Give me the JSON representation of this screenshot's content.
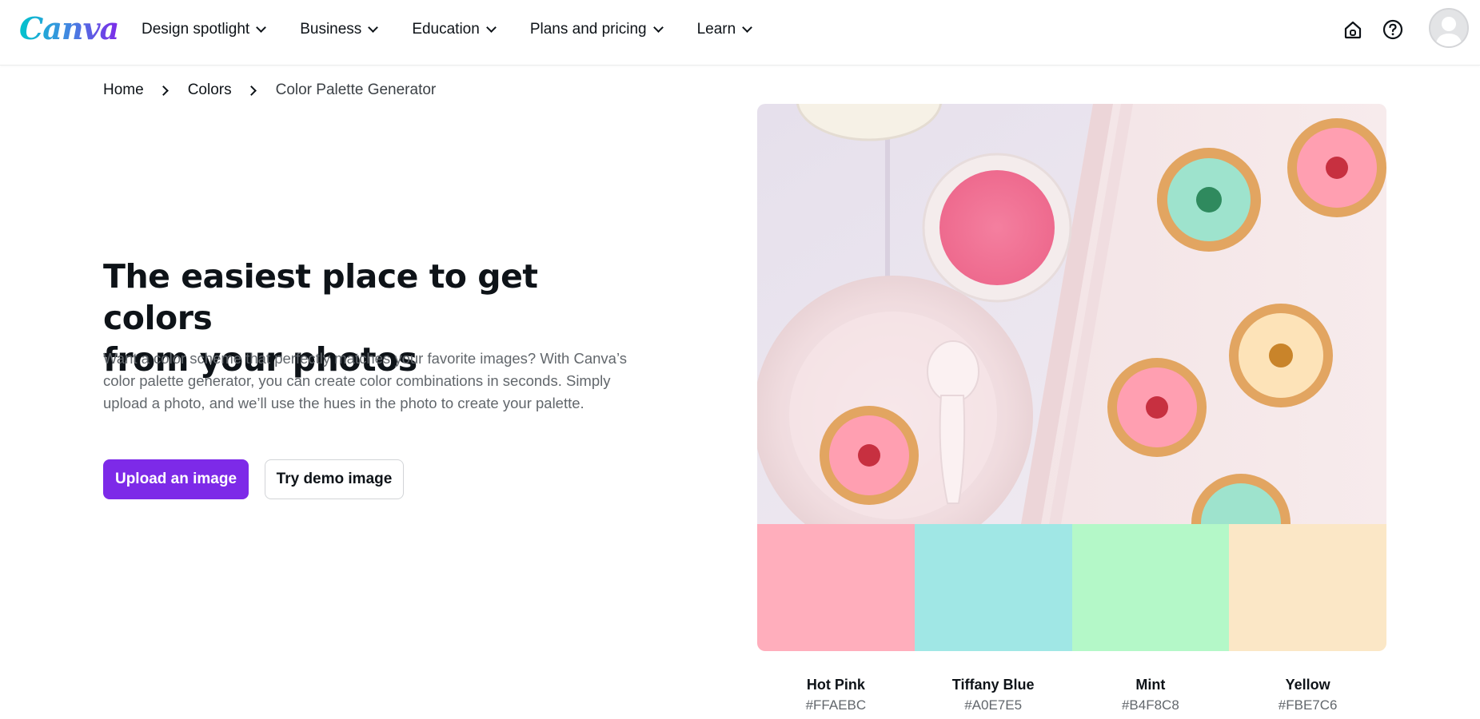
{
  "header": {
    "logo": "Canva",
    "nav": [
      {
        "label": "Design spotlight"
      },
      {
        "label": "Business"
      },
      {
        "label": "Education"
      },
      {
        "label": "Plans and pricing"
      },
      {
        "label": "Learn"
      }
    ],
    "icons": [
      "home-icon",
      "help-icon",
      "avatar"
    ]
  },
  "breadcrumb": {
    "items": [
      "Home",
      "Colors",
      "Color Palette Generator"
    ]
  },
  "hero": {
    "title_line1": "The easiest place to get colors",
    "title_line2": "from your photos",
    "description": "Want a color scheme that perfectly matches your favorite images? With Canva’s color palette generator, you can create color combinations in seconds. Simply upload a photo, and we’ll use the hues in the photo to create your palette.",
    "upload_label": "Upload an image",
    "demo_label": "Try demo image"
  },
  "palette": [
    {
      "name": "Hot Pink",
      "hex": "#FFAEBC",
      "color": "#FFAEBC"
    },
    {
      "name": "Tiffany Blue",
      "hex": "#A0E7E5",
      "color": "#A0E7E5"
    },
    {
      "name": "Mint",
      "hex": "#B4F8C8",
      "color": "#B4F8C8"
    },
    {
      "name": "Yellow",
      "hex": "#FBE7C6",
      "color": "#FBE7C6"
    }
  ],
  "colors": {
    "brand_purple": "#7d2ae8",
    "text_primary": "#0e1318",
    "text_secondary": "#62676c"
  }
}
